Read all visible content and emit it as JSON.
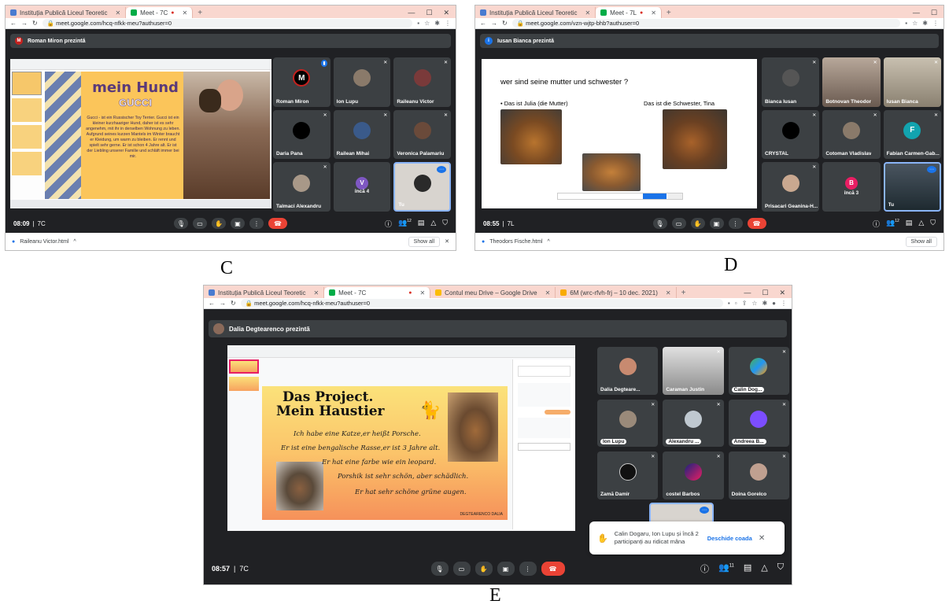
{
  "captions": {
    "c": "C",
    "d": "D",
    "e": "E"
  },
  "shot_c": {
    "tabs": [
      "Instituția Publică Liceul Teoretic",
      "Meet - 7C"
    ],
    "url": "meet.google.com/hcq-nfkk-meu?authuser=0",
    "presenter": "Roman Miron prezintă",
    "slide_title_1": "mein Hund",
    "slide_title_2": "GUCCI",
    "slide_text": "Gucci - ist ein Russischer Toy Terrier. Gucci ist ein kleiner kurzhaariger Hund, daher ist es sehr angenehm, mit ihr in derselben Wohnung zu leben. Aufgrund seines kurzen Mantels im Winter braucht er Kleidung, um warm zu bleiben. Er rennt und spielt sehr gerne. Er ist schon 4 Jahre alt. Er ist der Liebling unserer Familie und schläft immer bei mir.",
    "participants": [
      "Roman Miron",
      "Ion Lupu",
      "Raileanu Victor",
      "Daria Pana",
      "Railean Mihai",
      "Veronica Palamariu",
      "Talmaci Alexandru",
      "încă 4",
      "Tu"
    ],
    "time": "08:09",
    "sep": "|",
    "code": "7C",
    "count_badge": "12",
    "download": "Raileanu Victor.html",
    "show_all": "Show all"
  },
  "shot_d": {
    "tabs": [
      "Instituția Publică Liceul Teoretic",
      "Meet - 7L"
    ],
    "url": "meet.google.com/vzn-wjtp-bhb?authuser=0",
    "presenter": "Iusan Bianca prezintă",
    "question": "wer sind seine mutter und schwester ?",
    "left_label": "• Das ist Julia (die Mutter)",
    "right_label": "Das ist die Schwester, Tina",
    "participants": [
      "Bianca Iusan",
      "Botnovan Theodor",
      "Iusan Bianca",
      "CRYSTAL",
      "Cotoman Vladislav",
      "Fabian Carmen-Gab...",
      "Prisacari Geanina-H...",
      "încă 3",
      "Tu"
    ],
    "avatar_f": "F",
    "avatar_b": "B",
    "time": "08:55",
    "sep": "|",
    "code": "7L",
    "count_badge": "12",
    "download": "Theodors Fische.html",
    "show_all": "Show all"
  },
  "shot_e": {
    "tabs": [
      "Instituția Publică Liceul Teoretic",
      "Meet - 7C",
      "Contul meu Drive – Google Drive",
      "6M (wrc-rfvh-frj – 10 dec. 2021)"
    ],
    "url": "meet.google.com/hcq-nfkk-meu?authuser=0",
    "presenter": "Dalia Degtearenco prezintă",
    "slide_title_1": "Das Project.",
    "slide_title_2": "Mein Haustier",
    "slide_lines": [
      "Ich habe eine Katze,er heißt Porsche.",
      "Er ist eine bengalische Rasse,er ist 3 Jahre alt.",
      "Er hat eine farbe wie ein leopard.",
      "Porshik ist sehr schön, aber schädlich.",
      "Er hat sehr schöne grüne augen."
    ],
    "signature": "DEGTEARENCO DALIA",
    "participants": [
      "Dalia Degteare...",
      "Caraman Justin",
      "Calin Dog...",
      "Ion Lupu",
      "Alexandru ...",
      "Andreea B...",
      "Zamă Damir",
      "costel Barbos",
      "Doina Gorelco"
    ],
    "toast_text": "Calin Dogaru, Ion Lupu și încă 2 participanți au ridicat mâna",
    "toast_action": "Deschide coada",
    "time": "08:57",
    "sep": "|",
    "code": "7C",
    "count_badge": "11"
  },
  "colors": {
    "meet_bg": "#202124",
    "tile_bg": "#3c4043",
    "end_call": "#ea4335",
    "tab_strip": "#f9d7cf",
    "accent_blue": "#1a73e8"
  }
}
